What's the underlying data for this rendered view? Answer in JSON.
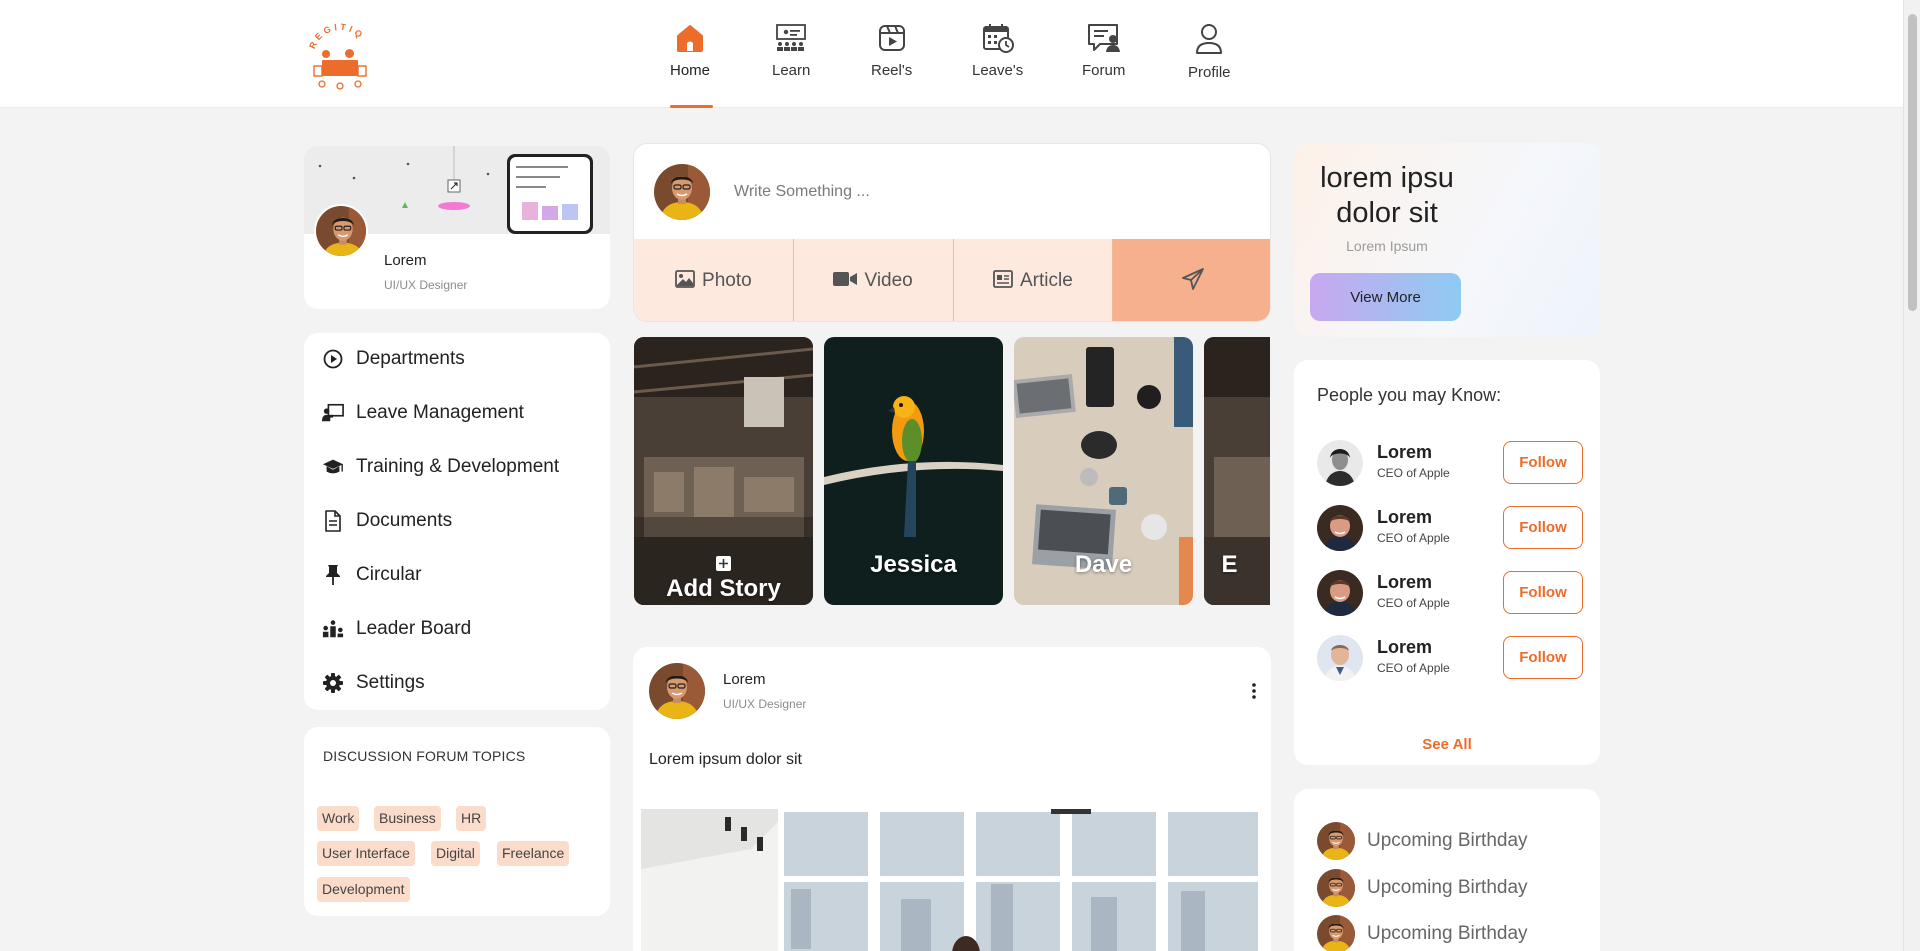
{
  "colors": {
    "accent": "#ec6d2b",
    "tag_bg": "#fbdccb",
    "action_bg": "#fde9de",
    "send_bg": "#f7b08d",
    "page_bg": "#f3f3f3"
  },
  "header": {
    "logo_text": "REGITIQ",
    "nav": [
      {
        "label": "Home",
        "icon": "home-icon",
        "active": true
      },
      {
        "label": "Learn",
        "icon": "learn-icon",
        "active": false
      },
      {
        "label": "Reel's",
        "icon": "reels-icon",
        "active": false
      },
      {
        "label": "Leave's",
        "icon": "calendar-icon",
        "active": false
      },
      {
        "label": "Forum",
        "icon": "forum-icon",
        "active": false
      },
      {
        "label": "Profile",
        "icon": "user-icon",
        "active": false
      }
    ]
  },
  "profile": {
    "name": "Lorem",
    "role": "UI/UX Designer"
  },
  "menu": {
    "items": [
      {
        "label": "Departments",
        "icon": "play-circle-icon"
      },
      {
        "label": "Leave Management",
        "icon": "presenter-icon"
      },
      {
        "label": "Training & Development",
        "icon": "graduation-cap-icon"
      },
      {
        "label": "Documents",
        "icon": "document-icon"
      },
      {
        "label": "Circular",
        "icon": "pin-icon"
      },
      {
        "label": "Leader Board",
        "icon": "leaderboard-icon"
      },
      {
        "label": "Settings",
        "icon": "gear-icon"
      }
    ]
  },
  "topics": {
    "title": "DISCUSSION FORUM TOPICS",
    "tags": [
      "Work",
      "Business",
      "HR",
      "User Interface",
      "Digital",
      "Freelance",
      "Development"
    ]
  },
  "composer": {
    "placeholder": "Write Something ...",
    "actions": [
      {
        "label": "Photo",
        "icon": "image-icon"
      },
      {
        "label": "Video",
        "icon": "video-icon"
      },
      {
        "label": "Article",
        "icon": "article-icon"
      },
      {
        "label": "",
        "icon": "send-icon"
      }
    ]
  },
  "stories": [
    {
      "label": "Add Story",
      "icon": "add-icon"
    },
    {
      "label": "Jessica"
    },
    {
      "label": "Dave"
    },
    {
      "label": "E"
    }
  ],
  "post": {
    "author": "Lorem",
    "role": "UI/UX Designer",
    "text": "Lorem ipsum dolor sit"
  },
  "promo": {
    "title": "lorem ipsu dolor sit",
    "subtitle": "Lorem Ipsum",
    "button": "View More"
  },
  "people": {
    "title": "People you may Know:",
    "items": [
      {
        "name": "Lorem",
        "role": "CEO of Apple",
        "button": "Follow"
      },
      {
        "name": "Lorem",
        "role": "CEO of Apple",
        "button": "Follow"
      },
      {
        "name": "Lorem",
        "role": "CEO of Apple",
        "button": "Follow"
      },
      {
        "name": "Lorem",
        "role": "CEO of Apple",
        "button": "Follow"
      }
    ],
    "see_all": "See All"
  },
  "birthdays": {
    "items": [
      {
        "label": "Upcoming Birthday"
      },
      {
        "label": "Upcoming Birthday"
      },
      {
        "label": "Upcoming Birthday"
      }
    ]
  }
}
